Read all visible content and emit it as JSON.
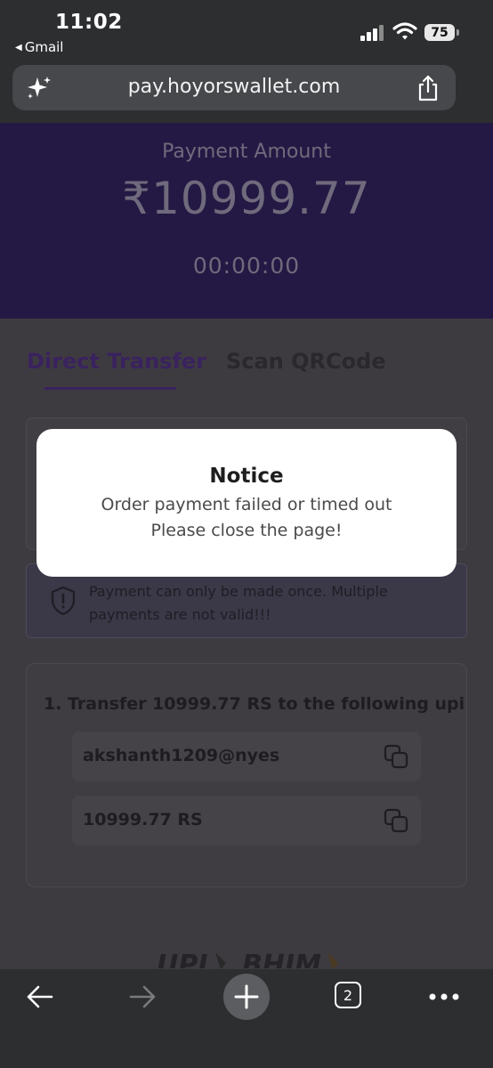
{
  "status_bar": {
    "time": "11:02",
    "back_app": "Gmail",
    "battery": "75",
    "icons": [
      "signal-icon",
      "wifi-icon",
      "battery-icon"
    ]
  },
  "browser": {
    "url": "pay.hoyorswallet.com",
    "tab_count": "2",
    "icons": [
      "sparkle-icon",
      "share-icon",
      "back-arrow-icon",
      "forward-arrow-icon",
      "plus-icon",
      "more-icon"
    ]
  },
  "payment": {
    "label": "Payment Amount",
    "amount": "₹10999.77",
    "timer": "00:00:00"
  },
  "tabs": [
    {
      "label": "Direct Transfer",
      "active": true
    },
    {
      "label": "Scan QRCode",
      "active": false
    }
  ],
  "warning": {
    "text": "Payment can only be made once. Multiple payments are not valid!!!"
  },
  "transfer": {
    "step_title": "1. Transfer 10999.77 RS to the following upi",
    "upi_id": "akshanth1209@nyes",
    "amount": "10999.77 RS"
  },
  "modal": {
    "title": "Notice",
    "line1": "Order payment failed or timed out",
    "line2": "Please close the page!"
  },
  "colors": {
    "header_bg": "#241944",
    "accent": "#3a225f",
    "modal_bg": "#ffffff"
  }
}
